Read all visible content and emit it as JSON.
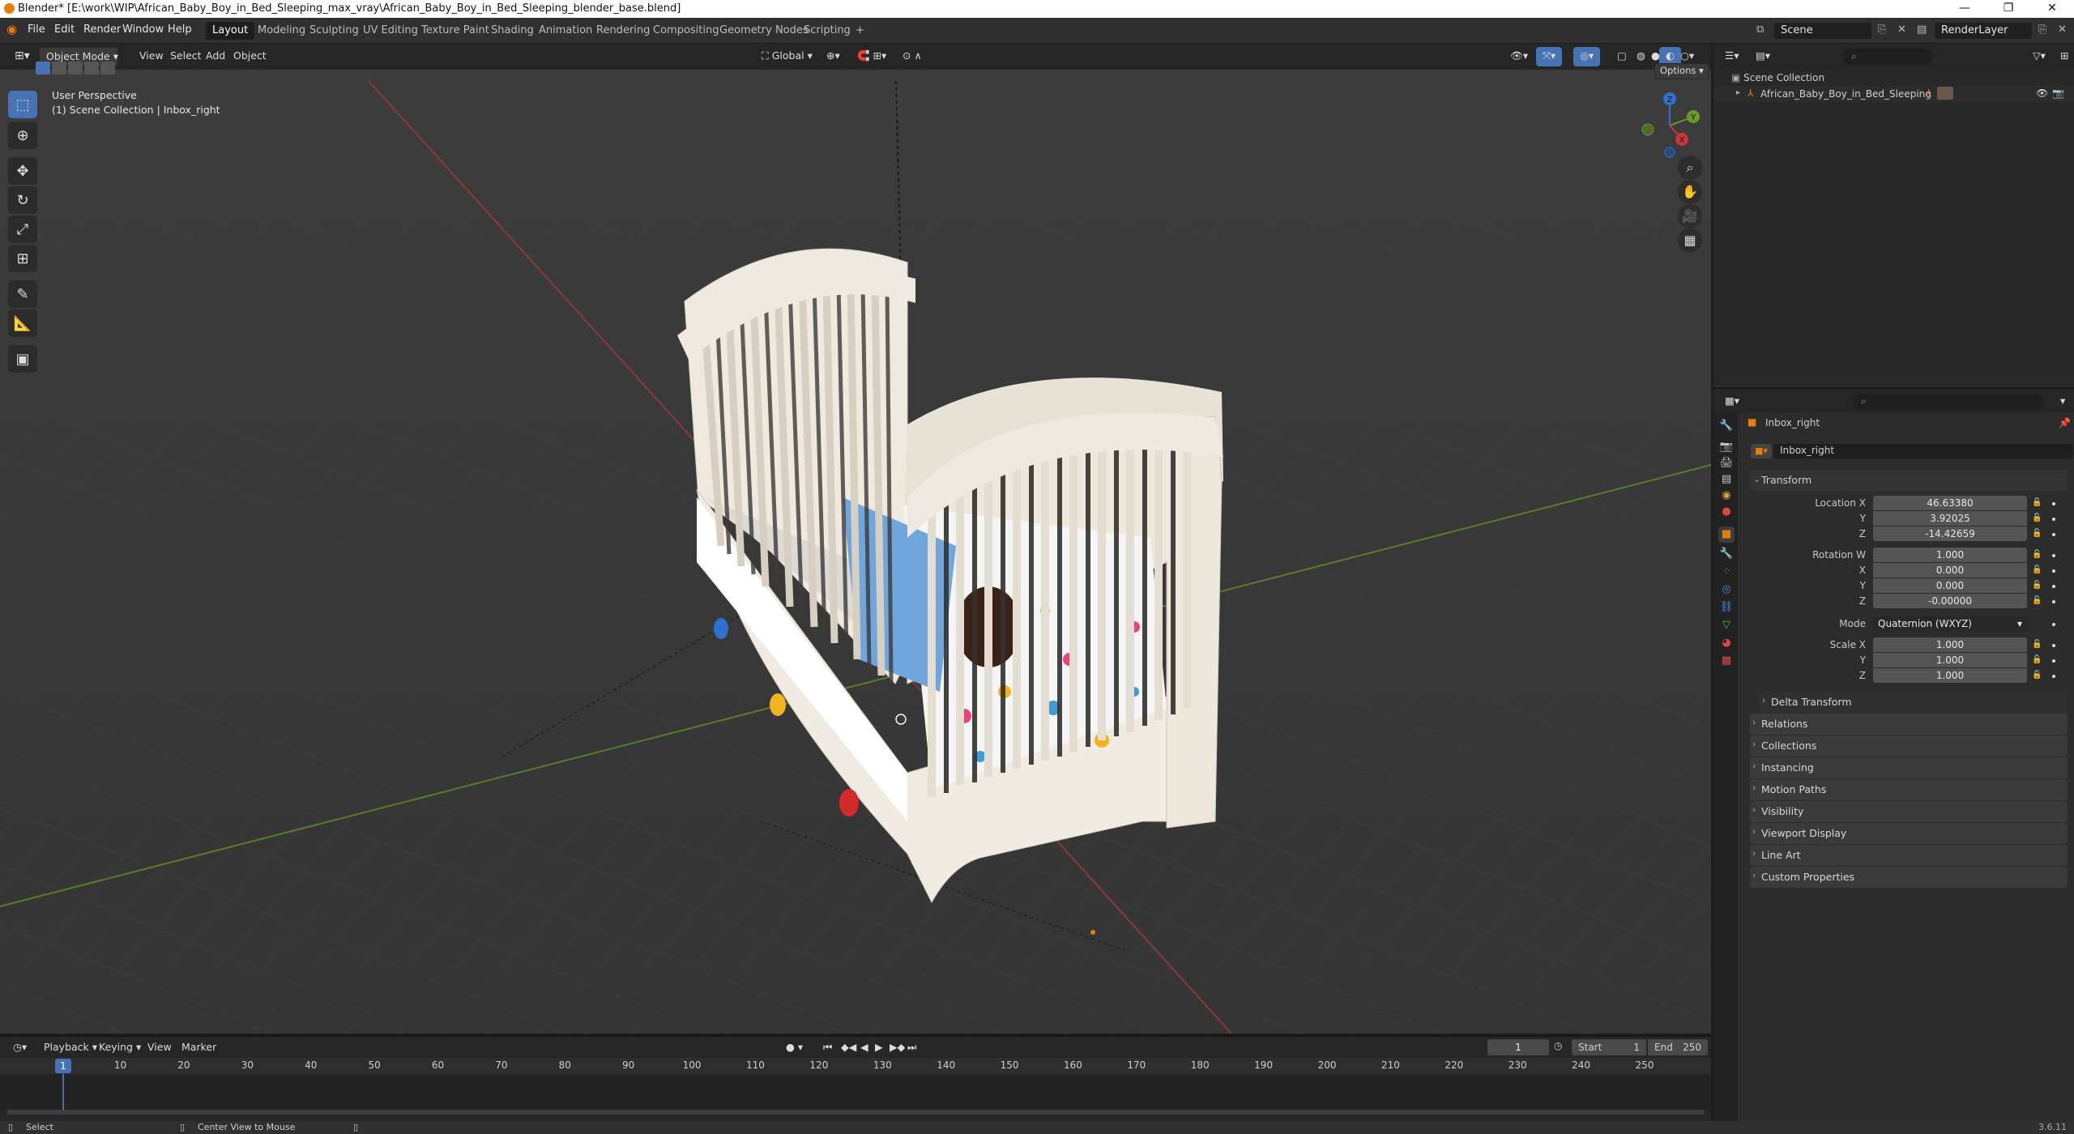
{
  "window": {
    "title": "Blender* [E:\\work\\WIP\\African_Baby_Boy_in_Bed_Sleeping_max_vray\\African_Baby_Boy_in_Bed_Sleeping_blender_base.blend]",
    "minimize": "—",
    "maximize": "❐",
    "close": "✕"
  },
  "menubar": {
    "menus": [
      "File",
      "Edit",
      "Render",
      "Window",
      "Help"
    ],
    "workspaces": [
      "Layout",
      "Modeling",
      "Sculpting",
      "UV Editing",
      "Texture Paint",
      "Shading",
      "Animation",
      "Rendering",
      "Compositing",
      "Geometry Nodes",
      "Scripting"
    ],
    "active_workspace": "Layout",
    "add_workspace": "+",
    "scene": "Scene",
    "view_layer": "RenderLayer"
  },
  "viewport_header": {
    "mode": "Object Mode",
    "menus": [
      "View",
      "Select",
      "Add",
      "Object"
    ],
    "transform_orientation": "Global",
    "options": "Options"
  },
  "viewport": {
    "perspective": "User Perspective",
    "collection_info": "(1) Scene Collection | Inbox_right",
    "gizmo_axes": [
      "X",
      "Y",
      "Z"
    ]
  },
  "outliner": {
    "root": "Scene Collection",
    "items": [
      "African_Baby_Boy_in_Bed_Sleeping"
    ]
  },
  "properties": {
    "object_name": "Inbox_right",
    "data_name": "Inbox_right",
    "transform_title": "Transform",
    "location": {
      "label": "Location X",
      "x": "46.63380",
      "y": "3.92025",
      "z": "-14.42659"
    },
    "rotation": {
      "label": "Rotation W",
      "w": "1.000",
      "x": "0.000",
      "y": "0.000",
      "z": "-0.00000"
    },
    "mode": {
      "label": "Mode",
      "value": "Quaternion (WXYZ)"
    },
    "scale": {
      "label": "Scale X",
      "x": "1.000",
      "y": "1.000",
      "z": "1.000"
    },
    "axis_labels": {
      "y": "Y",
      "z": "Z",
      "x": "X"
    },
    "delta_transform": "Delta Transform",
    "panels": [
      "Relations",
      "Collections",
      "Instancing",
      "Motion Paths",
      "Visibility",
      "Viewport Display",
      "Line Art",
      "Custom Properties"
    ]
  },
  "timeline": {
    "menus": [
      "Playback",
      "Keying",
      "View",
      "Marker"
    ],
    "current_frame": "1",
    "start_label": "Start",
    "start": "1",
    "end_label": "End",
    "end": "250",
    "ruler": [
      "10",
      "20",
      "30",
      "40",
      "50",
      "60",
      "70",
      "80",
      "90",
      "100",
      "110",
      "120",
      "130",
      "140",
      "150",
      "160",
      "170",
      "180",
      "190",
      "200",
      "210",
      "220",
      "230",
      "240",
      "250"
    ]
  },
  "statusbar": {
    "select": "Select",
    "center_view": "Center View to Mouse",
    "version": "3.6.11"
  },
  "colors": {
    "accent": "#4772b3",
    "x_axis": "#c4383a",
    "y_axis": "#6b9a2a",
    "z_axis": "#2f6fd0"
  }
}
